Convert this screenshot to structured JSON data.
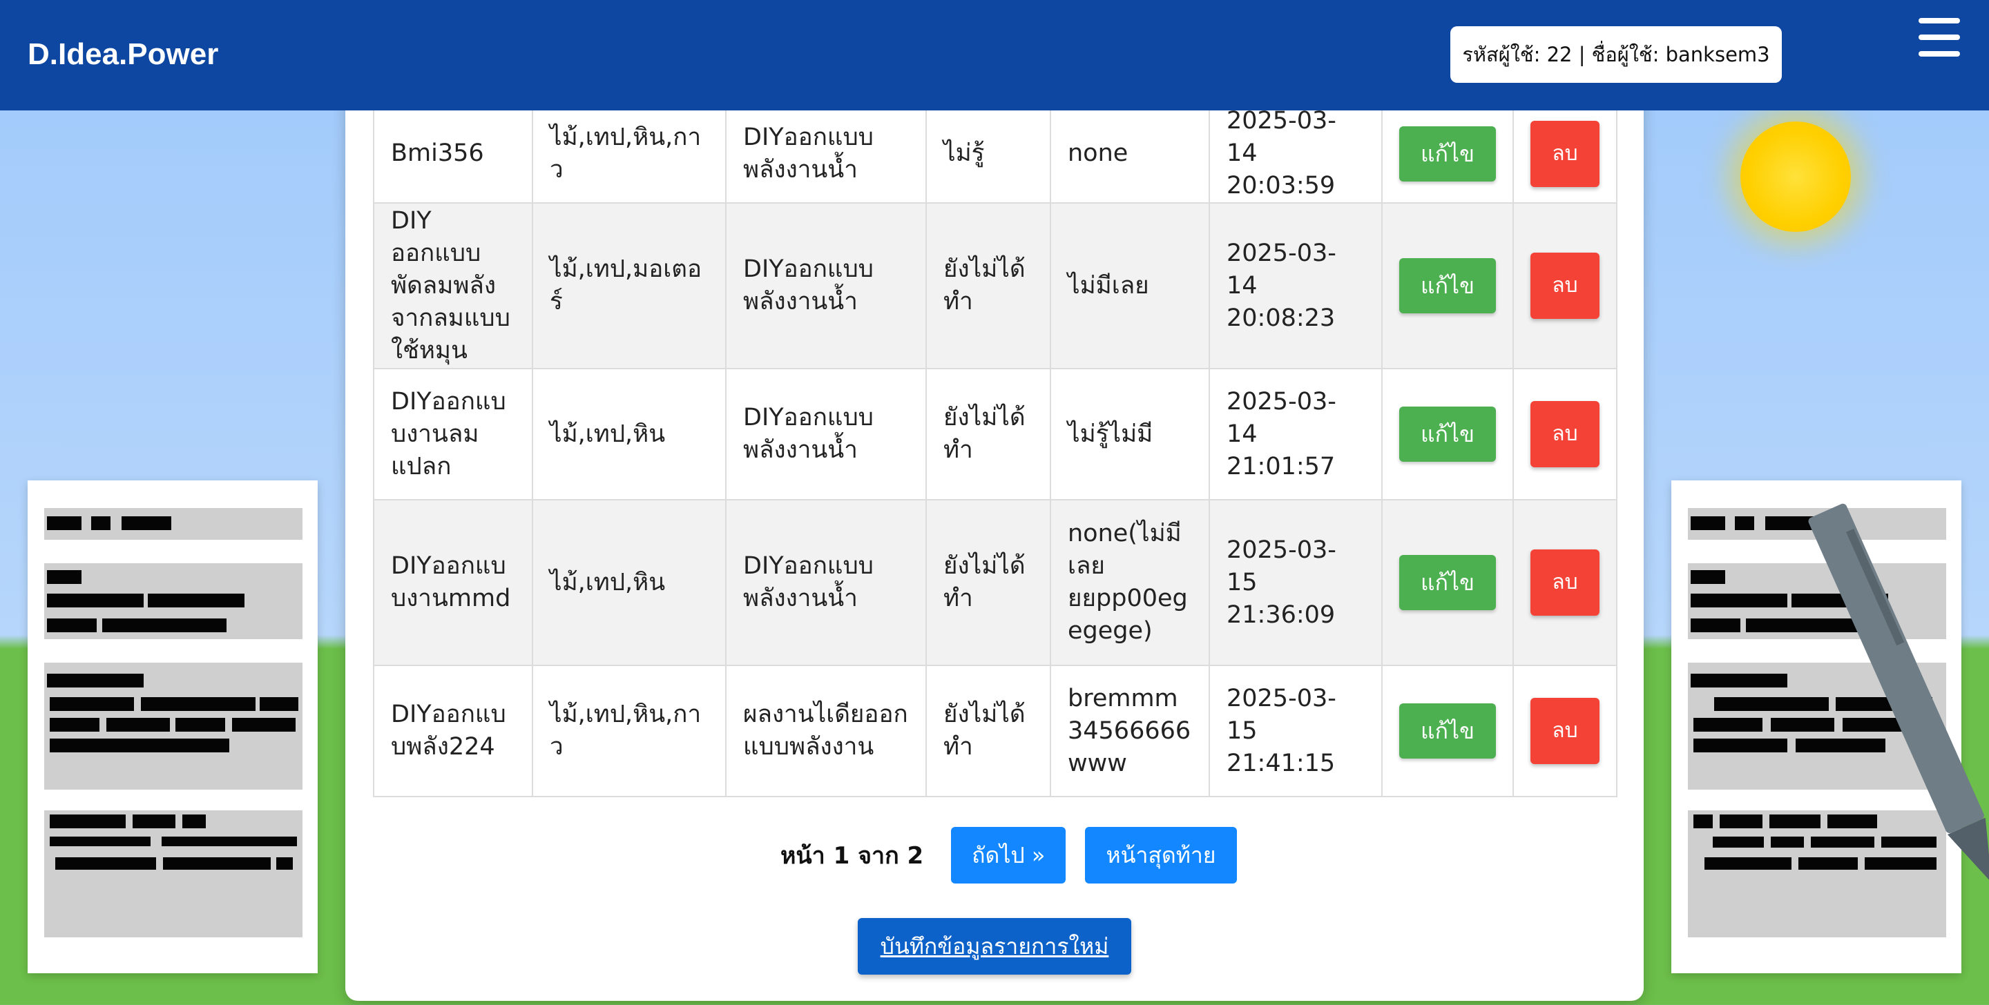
{
  "header": {
    "logo": "D.Idea.Power",
    "user_info": "รหัสผู้ใช้: 22 | ชื่อผู้ใช้: banksem3"
  },
  "table": {
    "rows": [
      {
        "name": "Bmi356",
        "materials": "ไม้,เทป,หิน,กาว",
        "category": "DIYออกแบบพลังงานน้ำ",
        "status": "ไม่รู้",
        "note": "none",
        "date": "2025-03-14 20:03:59",
        "edit": "แก้ไข",
        "delete": "ลบ"
      },
      {
        "name": "DIY ออกแบบ พัดลมพลังจากลมแบบใช้หมุน",
        "materials": "ไม้,เทป,มอเตอร์",
        "category": "DIYออกแบบพลังงานน้ำ",
        "status": "ยังไม่ได้ทำ",
        "note": "ไม่มีเลย",
        "date": "2025-03-14 20:08:23",
        "edit": "แก้ไข",
        "delete": "ลบ"
      },
      {
        "name": "DIYออกแบบงานลมแปลก",
        "materials": "ไม้,เทป,หิน",
        "category": "DIYออกแบบพลังงานน้ำ",
        "status": "ยังไม่ได้ทำ",
        "note": "ไม่รู้ไม่มี",
        "date": "2025-03-14 21:01:57",
        "edit": "แก้ไข",
        "delete": "ลบ"
      },
      {
        "name": "DIYออกแบบงานmmd",
        "materials": "ไม้,เทป,หิน",
        "category": "DIYออกแบบพลังงานน้ำ",
        "status": "ยังไม่ได้ทำ",
        "note": "none(ไม่มีเลย ยยpp00egegege)",
        "date": "2025-03-15 21:36:09",
        "edit": "แก้ไข",
        "delete": "ลบ"
      },
      {
        "name": "DIYออกแบบพลัง224",
        "materials": "ไม้,เทป,หิน,กาว",
        "category": "ผลงานไเดียออกแบบพลังงาน",
        "status": "ยังไม่ได้ทำ",
        "note": "bremmm34566666www",
        "date": "2025-03-15 21:41:15",
        "edit": "แก้ไข",
        "delete": "ลบ"
      }
    ]
  },
  "pagination": {
    "info": "หน้า 1 จาก 2",
    "next": "ถัดไป »",
    "last": "หน้าสุดท้าย"
  },
  "actions": {
    "save_new": "บันทึกข้อมูลรายการใหม่"
  },
  "colors": {
    "header": "#0d47a1",
    "edit": "#4caf50",
    "delete": "#f44336",
    "pager": "#1287ff",
    "save": "#0d62c9"
  },
  "icons": [
    "menu-icon",
    "sun-illustration",
    "pen-illustration",
    "document-illustration"
  ]
}
